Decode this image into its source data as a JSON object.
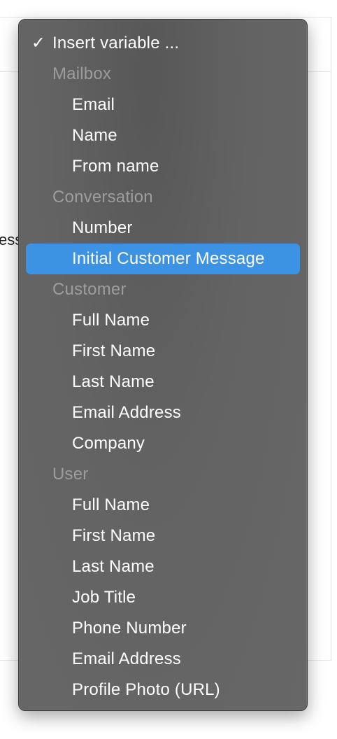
{
  "background": {
    "partial_text": "ess"
  },
  "menu": {
    "selected_label": "Insert variable ...",
    "check_glyph": "✓",
    "groups": [
      {
        "header": "Mailbox",
        "items": [
          "Email",
          "Name",
          "From name"
        ]
      },
      {
        "header": "Conversation",
        "items": [
          "Number",
          "Initial Customer Message"
        ]
      },
      {
        "header": "Customer",
        "items": [
          "Full Name",
          "First Name",
          "Last Name",
          "Email Address",
          "Company"
        ]
      },
      {
        "header": "User",
        "items": [
          "Full Name",
          "First Name",
          "Last Name",
          "Job Title",
          "Phone Number",
          "Email Address",
          "Profile Photo (URL)"
        ]
      }
    ],
    "highlighted_item": "Initial Customer Message",
    "colors": {
      "background": "#656565",
      "highlight": "#3d93e3",
      "header_text": "#9d9d9d",
      "item_text": "#ffffff"
    }
  }
}
